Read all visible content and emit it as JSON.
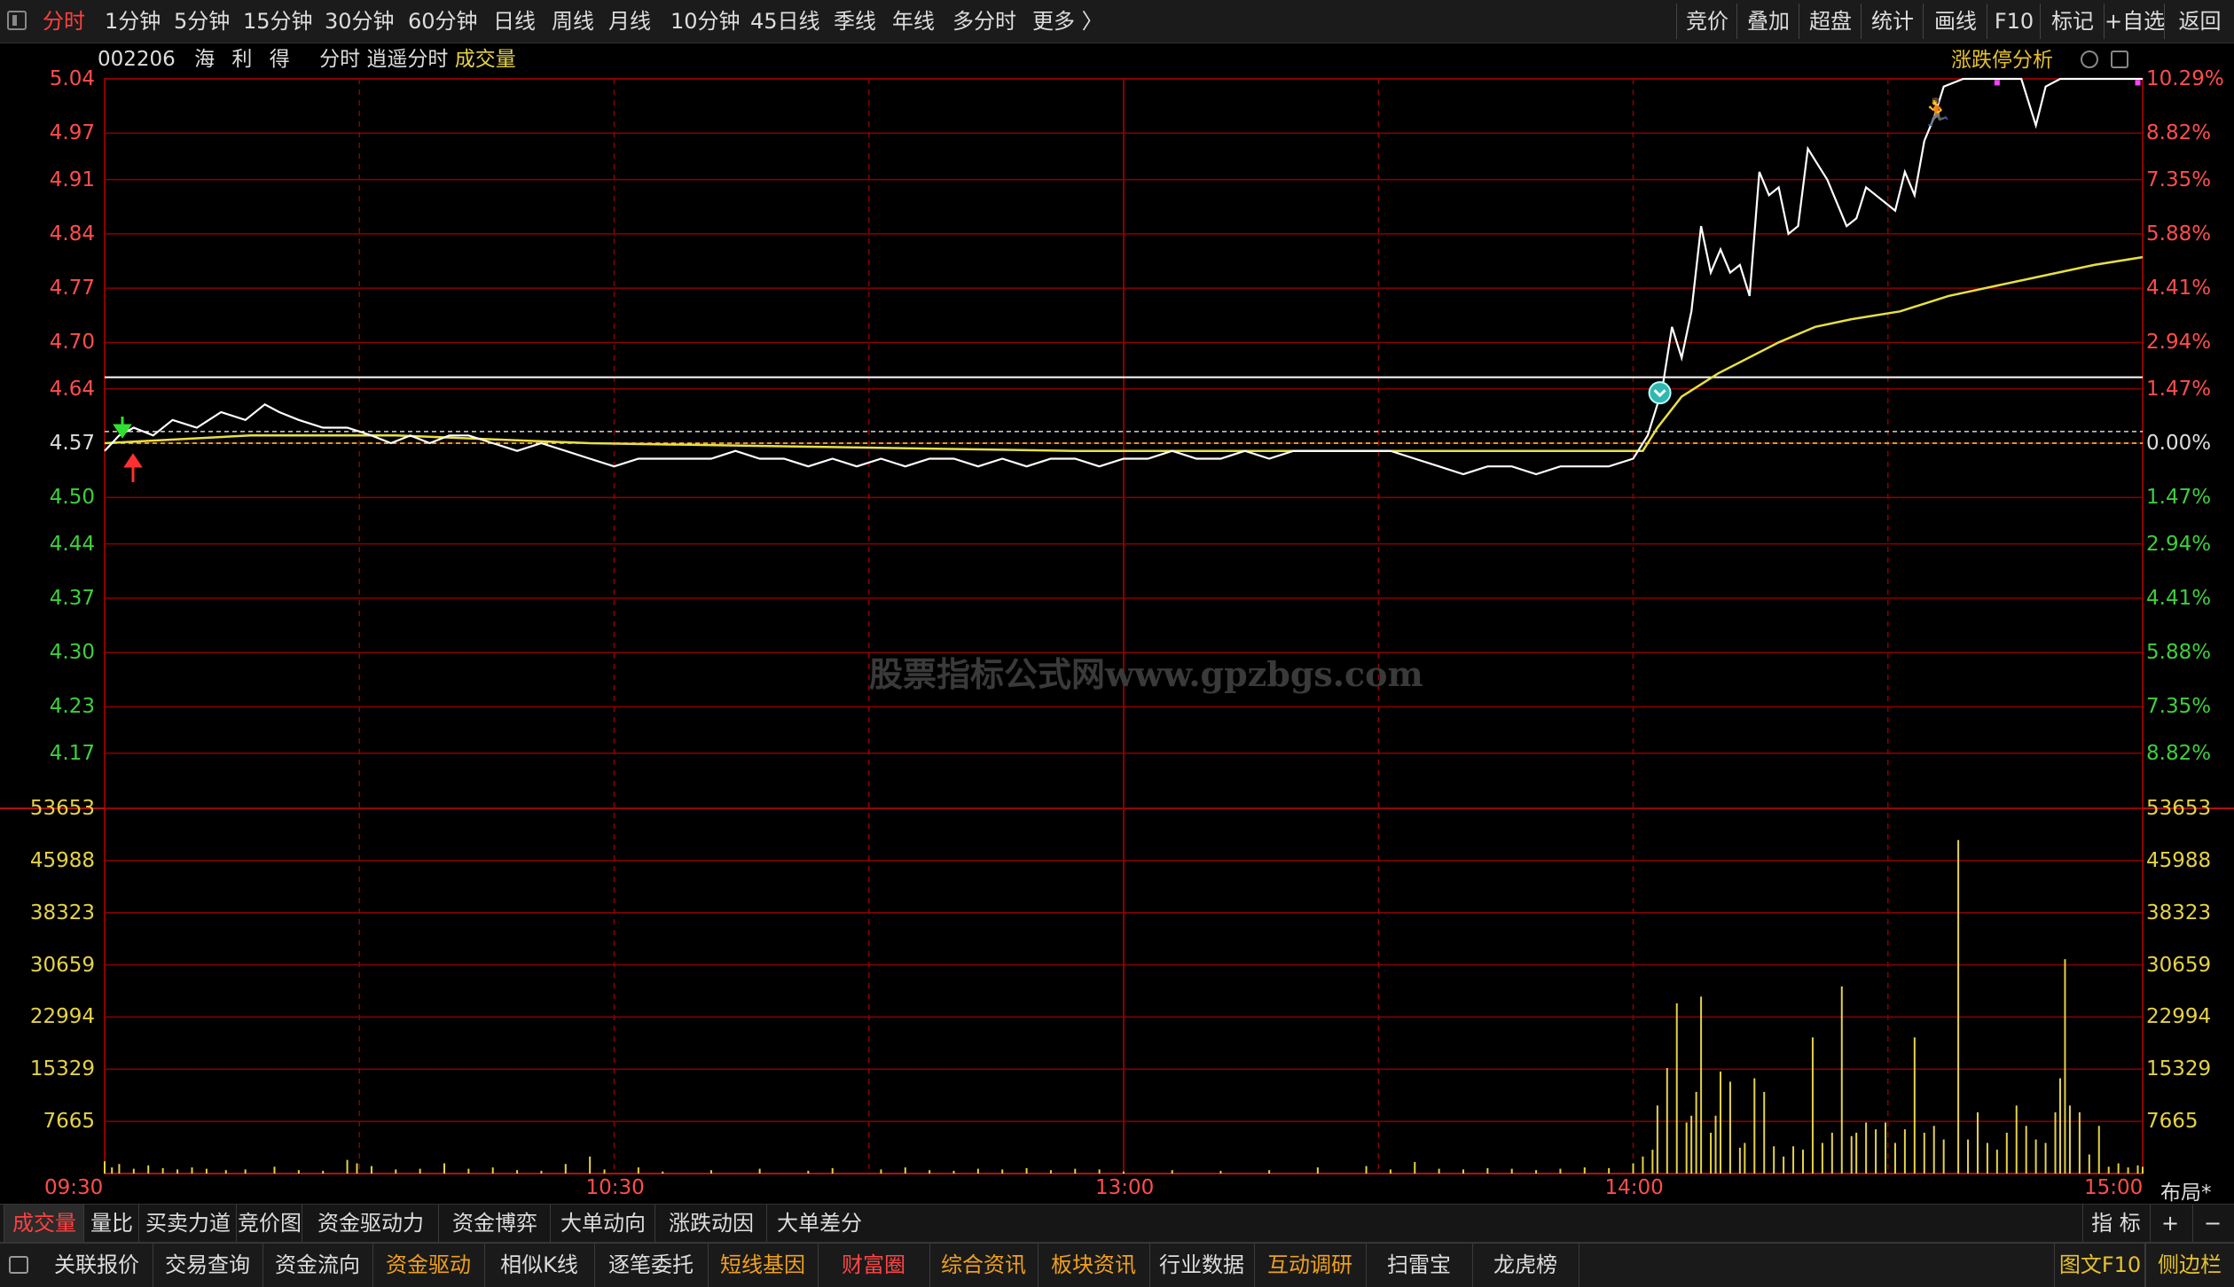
{
  "toolbar": {
    "timeframes": [
      "分时",
      "1分钟",
      "5分钟",
      "15分钟",
      "30分钟",
      "60分钟",
      "日线",
      "周线",
      "月线",
      "10分钟",
      "45日线",
      "季线",
      "年线",
      "多分时",
      "更多 〉"
    ],
    "active_index": 0,
    "right_buttons": [
      "竞价",
      "叠加",
      "超盘",
      "统计",
      "画线",
      "F10",
      "标记",
      "+自选",
      "返回"
    ]
  },
  "info": {
    "code": "002206",
    "name": "海 利 得",
    "mode": "分时 逍遥分时",
    "indicator": "成交量",
    "right_label": "涨跌停分析"
  },
  "axes": {
    "price_labels": [
      "5.04",
      "4.97",
      "4.91",
      "4.84",
      "4.77",
      "4.70",
      "4.64",
      "4.57",
      "4.50",
      "4.44",
      "4.37",
      "4.30",
      "4.23",
      "4.17"
    ],
    "pct_labels": [
      "10.29%",
      "8.82%",
      "7.35%",
      "5.88%",
      "4.41%",
      "2.94%",
      "1.47%",
      "0.00%",
      "1.47%",
      "2.94%",
      "4.41%",
      "5.88%",
      "7.35%",
      "8.82%"
    ],
    "volume_labels": [
      "53653",
      "45988",
      "38323",
      "30659",
      "22994",
      "15329",
      "7665"
    ],
    "time_labels": [
      "09:30",
      "10:30",
      "13:00",
      "14:00",
      "15:00"
    ]
  },
  "watermark": "股票指标公式网www.gpzbgs.com",
  "layout_label": "布局*",
  "indicator_tabs": [
    "成交量",
    "量比",
    "买卖力道",
    "竞价图",
    "资金驱动力",
    "资金博弈",
    "大单动向",
    "涨跌动因",
    "大单差分"
  ],
  "indicator_right": [
    "指 标",
    "+",
    "−"
  ],
  "bottom_bar": [
    "关联报价",
    "交易查询",
    "资金流向",
    "资金驱动",
    "相似K线",
    "逐笔委托",
    "短线基因",
    "财富圈",
    "综合资讯",
    "板块资讯",
    "行业数据",
    "互动调研",
    "扫雷宝",
    "龙虎榜"
  ],
  "bottom_right": [
    "图文F10",
    "侧边栏"
  ],
  "colors": {
    "price_line": "#ffffff",
    "avg_line": "#e8e040",
    "volume_bar": "#e5d247",
    "grid": "#8b0000",
    "up": "#ff4d4d",
    "down": "#3ecf3e"
  },
  "chart_data": {
    "type": "line",
    "prev_close": 4.57,
    "price_range": [
      4.1,
      5.04
    ],
    "volume_range": [
      0,
      53653
    ],
    "sessions": [
      "09:30",
      "11:30/13:00",
      "15:00"
    ],
    "price": [
      [
        0,
        4.56
      ],
      [
        6,
        4.58
      ],
      [
        12,
        4.59
      ],
      [
        20,
        4.58
      ],
      [
        28,
        4.6
      ],
      [
        38,
        4.59
      ],
      [
        48,
        4.61
      ],
      [
        58,
        4.6
      ],
      [
        66,
        4.62
      ],
      [
        72,
        4.61
      ],
      [
        80,
        4.6
      ],
      [
        90,
        4.59
      ],
      [
        100,
        4.59
      ],
      [
        110,
        4.58
      ],
      [
        118,
        4.57
      ],
      [
        126,
        4.58
      ],
      [
        134,
        4.57
      ],
      [
        142,
        4.58
      ],
      [
        150,
        4.58
      ],
      [
        160,
        4.57
      ],
      [
        170,
        4.56
      ],
      [
        180,
        4.57
      ],
      [
        190,
        4.56
      ],
      [
        200,
        4.55
      ],
      [
        210,
        4.54
      ],
      [
        220,
        4.55
      ],
      [
        230,
        4.55
      ],
      [
        240,
        4.55
      ],
      [
        250,
        4.55
      ],
      [
        260,
        4.56
      ],
      [
        270,
        4.55
      ],
      [
        280,
        4.55
      ],
      [
        290,
        4.54
      ],
      [
        300,
        4.55
      ],
      [
        310,
        4.54
      ],
      [
        320,
        4.55
      ],
      [
        330,
        4.54
      ],
      [
        340,
        4.55
      ],
      [
        350,
        4.55
      ],
      [
        360,
        4.54
      ],
      [
        370,
        4.55
      ],
      [
        380,
        4.54
      ],
      [
        390,
        4.55
      ],
      [
        400,
        4.55
      ],
      [
        410,
        4.54
      ],
      [
        420,
        4.55
      ],
      [
        430,
        4.55
      ],
      [
        440,
        4.56
      ],
      [
        450,
        4.55
      ],
      [
        460,
        4.55
      ],
      [
        470,
        4.56
      ],
      [
        480,
        4.55
      ],
      [
        490,
        4.56
      ],
      [
        500,
        4.56
      ],
      [
        510,
        4.56
      ],
      [
        520,
        4.56
      ],
      [
        530,
        4.56
      ],
      [
        540,
        4.55
      ],
      [
        550,
        4.54
      ],
      [
        560,
        4.53
      ],
      [
        570,
        4.54
      ],
      [
        580,
        4.54
      ],
      [
        590,
        4.53
      ],
      [
        600,
        4.54
      ],
      [
        610,
        4.54
      ],
      [
        620,
        4.54
      ],
      [
        630,
        4.55
      ],
      [
        636,
        4.58
      ],
      [
        642,
        4.64
      ],
      [
        646,
        4.72
      ],
      [
        650,
        4.68
      ],
      [
        654,
        4.74
      ],
      [
        658,
        4.85
      ],
      [
        662,
        4.79
      ],
      [
        666,
        4.82
      ],
      [
        670,
        4.79
      ],
      [
        674,
        4.8
      ],
      [
        678,
        4.76
      ],
      [
        682,
        4.92
      ],
      [
        686,
        4.89
      ],
      [
        690,
        4.9
      ],
      [
        694,
        4.84
      ],
      [
        698,
        4.85
      ],
      [
        702,
        4.95
      ],
      [
        706,
        4.93
      ],
      [
        710,
        4.91
      ],
      [
        714,
        4.88
      ],
      [
        718,
        4.85
      ],
      [
        722,
        4.86
      ],
      [
        726,
        4.9
      ],
      [
        730,
        4.89
      ],
      [
        734,
        4.88
      ],
      [
        738,
        4.87
      ],
      [
        742,
        4.92
      ],
      [
        746,
        4.89
      ],
      [
        750,
        4.96
      ],
      [
        754,
        4.99
      ],
      [
        758,
        5.03
      ],
      [
        766,
        5.04
      ],
      [
        790,
        5.04
      ],
      [
        796,
        4.98
      ],
      [
        800,
        5.03
      ],
      [
        806,
        5.04
      ],
      [
        840,
        5.04
      ]
    ],
    "avg": [
      [
        0,
        4.57
      ],
      [
        60,
        4.58
      ],
      [
        120,
        4.58
      ],
      [
        200,
        4.57
      ],
      [
        300,
        4.565
      ],
      [
        400,
        4.56
      ],
      [
        500,
        4.56
      ],
      [
        600,
        4.56
      ],
      [
        634,
        4.56
      ],
      [
        640,
        4.59
      ],
      [
        650,
        4.63
      ],
      [
        665,
        4.66
      ],
      [
        690,
        4.7
      ],
      [
        705,
        4.72
      ],
      [
        720,
        4.73
      ],
      [
        740,
        4.74
      ],
      [
        760,
        4.76
      ],
      [
        790,
        4.78
      ],
      [
        820,
        4.8
      ],
      [
        840,
        4.81
      ]
    ],
    "volume": [
      [
        0,
        1800
      ],
      [
        3,
        900
      ],
      [
        6,
        1400
      ],
      [
        12,
        700
      ],
      [
        18,
        1200
      ],
      [
        24,
        800
      ],
      [
        30,
        600
      ],
      [
        36,
        900
      ],
      [
        42,
        700
      ],
      [
        50,
        500
      ],
      [
        58,
        600
      ],
      [
        70,
        1000
      ],
      [
        80,
        500
      ],
      [
        90,
        400
      ],
      [
        100,
        2000
      ],
      [
        104,
        1500
      ],
      [
        110,
        1100
      ],
      [
        120,
        600
      ],
      [
        130,
        700
      ],
      [
        140,
        1500
      ],
      [
        150,
        700
      ],
      [
        160,
        900
      ],
      [
        170,
        500
      ],
      [
        180,
        400
      ],
      [
        190,
        1400
      ],
      [
        200,
        2500
      ],
      [
        206,
        600
      ],
      [
        220,
        900
      ],
      [
        230,
        300
      ],
      [
        250,
        500
      ],
      [
        270,
        700
      ],
      [
        290,
        400
      ],
      [
        300,
        800
      ],
      [
        320,
        600
      ],
      [
        330,
        900
      ],
      [
        340,
        500
      ],
      [
        350,
        400
      ],
      [
        360,
        700
      ],
      [
        370,
        600
      ],
      [
        380,
        800
      ],
      [
        390,
        500
      ],
      [
        400,
        700
      ],
      [
        410,
        600
      ],
      [
        420,
        300
      ],
      [
        440,
        500
      ],
      [
        460,
        400
      ],
      [
        480,
        500
      ],
      [
        500,
        900
      ],
      [
        520,
        1100
      ],
      [
        530,
        600
      ],
      [
        540,
        1700
      ],
      [
        550,
        700
      ],
      [
        560,
        600
      ],
      [
        570,
        800
      ],
      [
        580,
        700
      ],
      [
        590,
        500
      ],
      [
        600,
        700
      ],
      [
        610,
        900
      ],
      [
        620,
        800
      ],
      [
        630,
        1500
      ],
      [
        634,
        2500
      ],
      [
        638,
        3500
      ],
      [
        640,
        10000
      ],
      [
        644,
        15500
      ],
      [
        648,
        25000
      ],
      [
        652,
        7500
      ],
      [
        654,
        8500
      ],
      [
        656,
        12000
      ],
      [
        658,
        26000
      ],
      [
        662,
        6000
      ],
      [
        664,
        8500
      ],
      [
        666,
        15000
      ],
      [
        670,
        13500
      ],
      [
        674,
        3800
      ],
      [
        676,
        4500
      ],
      [
        680,
        14000
      ],
      [
        684,
        12000
      ],
      [
        688,
        4000
      ],
      [
        692,
        2500
      ],
      [
        696,
        4000
      ],
      [
        700,
        3500
      ],
      [
        704,
        20000
      ],
      [
        708,
        4500
      ],
      [
        712,
        6000
      ],
      [
        716,
        27500
      ],
      [
        720,
        5500
      ],
      [
        722,
        6000
      ],
      [
        726,
        7500
      ],
      [
        730,
        6500
      ],
      [
        734,
        7500
      ],
      [
        738,
        4500
      ],
      [
        742,
        6500
      ],
      [
        746,
        20000
      ],
      [
        750,
        6000
      ],
      [
        754,
        7000
      ],
      [
        758,
        5000
      ],
      [
        764,
        49000
      ],
      [
        768,
        5000
      ],
      [
        772,
        9000
      ],
      [
        776,
        4500
      ],
      [
        780,
        3500
      ],
      [
        784,
        6000
      ],
      [
        788,
        10000
      ],
      [
        792,
        7000
      ],
      [
        796,
        5000
      ],
      [
        800,
        4500
      ],
      [
        804,
        9000
      ],
      [
        806,
        14000
      ],
      [
        808,
        31500
      ],
      [
        810,
        10000
      ],
      [
        814,
        9000
      ],
      [
        818,
        2800
      ],
      [
        822,
        7000
      ],
      [
        826,
        1000
      ],
      [
        830,
        1500
      ],
      [
        834,
        900
      ],
      [
        838,
        1200
      ],
      [
        840,
        1000
      ]
    ],
    "n_minutes": 240
  }
}
